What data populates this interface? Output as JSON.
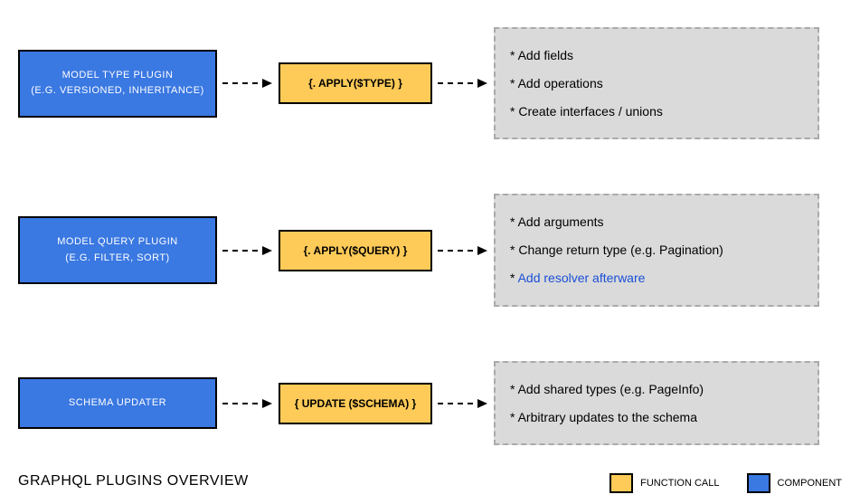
{
  "title": "GRAPHQL PLUGINS OVERVIEW",
  "legend": {
    "function": "FUNCTION CALL",
    "component": "COMPONENT"
  },
  "rows": [
    {
      "component": {
        "line1": "MODEL TYPE PLUGIN",
        "line2": "(E.G. VERSIONED, INHERITANCE)"
      },
      "func": "{. APPLY($TYPE) }",
      "desc": [
        {
          "text": "* Add fields",
          "link": false
        },
        {
          "text": "* Add operations",
          "link": false
        },
        {
          "text": "* Create interfaces / unions",
          "link": false
        }
      ]
    },
    {
      "component": {
        "line1": "MODEL QUERY PLUGIN",
        "line2": "(E.G. FILTER, SORT)"
      },
      "func": "{. APPLY($QUERY) }",
      "desc": [
        {
          "text": "* Add arguments",
          "link": false
        },
        {
          "text": "* Change return type (e.g. Pagination)",
          "link": false
        },
        {
          "text": "* Add resolver afterware",
          "link": true,
          "prefix": "* "
        }
      ]
    },
    {
      "component": {
        "line1": "SCHEMA UPDATER",
        "line2": ""
      },
      "func": "{  UPDATE ($SCHEMA)  }",
      "desc": [
        {
          "text": "* Add shared types (e.g. PageInfo)",
          "link": false
        },
        {
          "text": "* Arbitrary updates to the schema",
          "link": false
        }
      ]
    }
  ],
  "chart_data": {
    "type": "diagram",
    "nodes": [
      {
        "id": "c1",
        "kind": "component",
        "label": "MODEL TYPE PLUGIN (E.G. VERSIONED, INHERITANCE)"
      },
      {
        "id": "f1",
        "kind": "function",
        "label": "{. APPLY($TYPE) }"
      },
      {
        "id": "d1",
        "kind": "description",
        "items": [
          "Add fields",
          "Add operations",
          "Create interfaces / unions"
        ]
      },
      {
        "id": "c2",
        "kind": "component",
        "label": "MODEL QUERY PLUGIN (E.G. FILTER, SORT)"
      },
      {
        "id": "f2",
        "kind": "function",
        "label": "{. APPLY($QUERY) }"
      },
      {
        "id": "d2",
        "kind": "description",
        "items": [
          "Add arguments",
          "Change return type (e.g. Pagination)",
          "Add resolver afterware"
        ]
      },
      {
        "id": "c3",
        "kind": "component",
        "label": "SCHEMA UPDATER"
      },
      {
        "id": "f3",
        "kind": "function",
        "label": "{ UPDATE ($SCHEMA) }"
      },
      {
        "id": "d3",
        "kind": "description",
        "items": [
          "Add shared types (e.g. PageInfo)",
          "Arbitrary updates to the schema"
        ]
      }
    ],
    "edges": [
      {
        "from": "c1",
        "to": "f1",
        "style": "dashed"
      },
      {
        "from": "f1",
        "to": "d1",
        "style": "dashed"
      },
      {
        "from": "c2",
        "to": "f2",
        "style": "dashed"
      },
      {
        "from": "f2",
        "to": "d2",
        "style": "dashed"
      },
      {
        "from": "c3",
        "to": "f3",
        "style": "dashed"
      },
      {
        "from": "f3",
        "to": "d3",
        "style": "dashed"
      }
    ],
    "title": "GRAPHQL PLUGINS OVERVIEW",
    "legend": {
      "yellow": "FUNCTION CALL",
      "blue": "COMPONENT"
    }
  }
}
